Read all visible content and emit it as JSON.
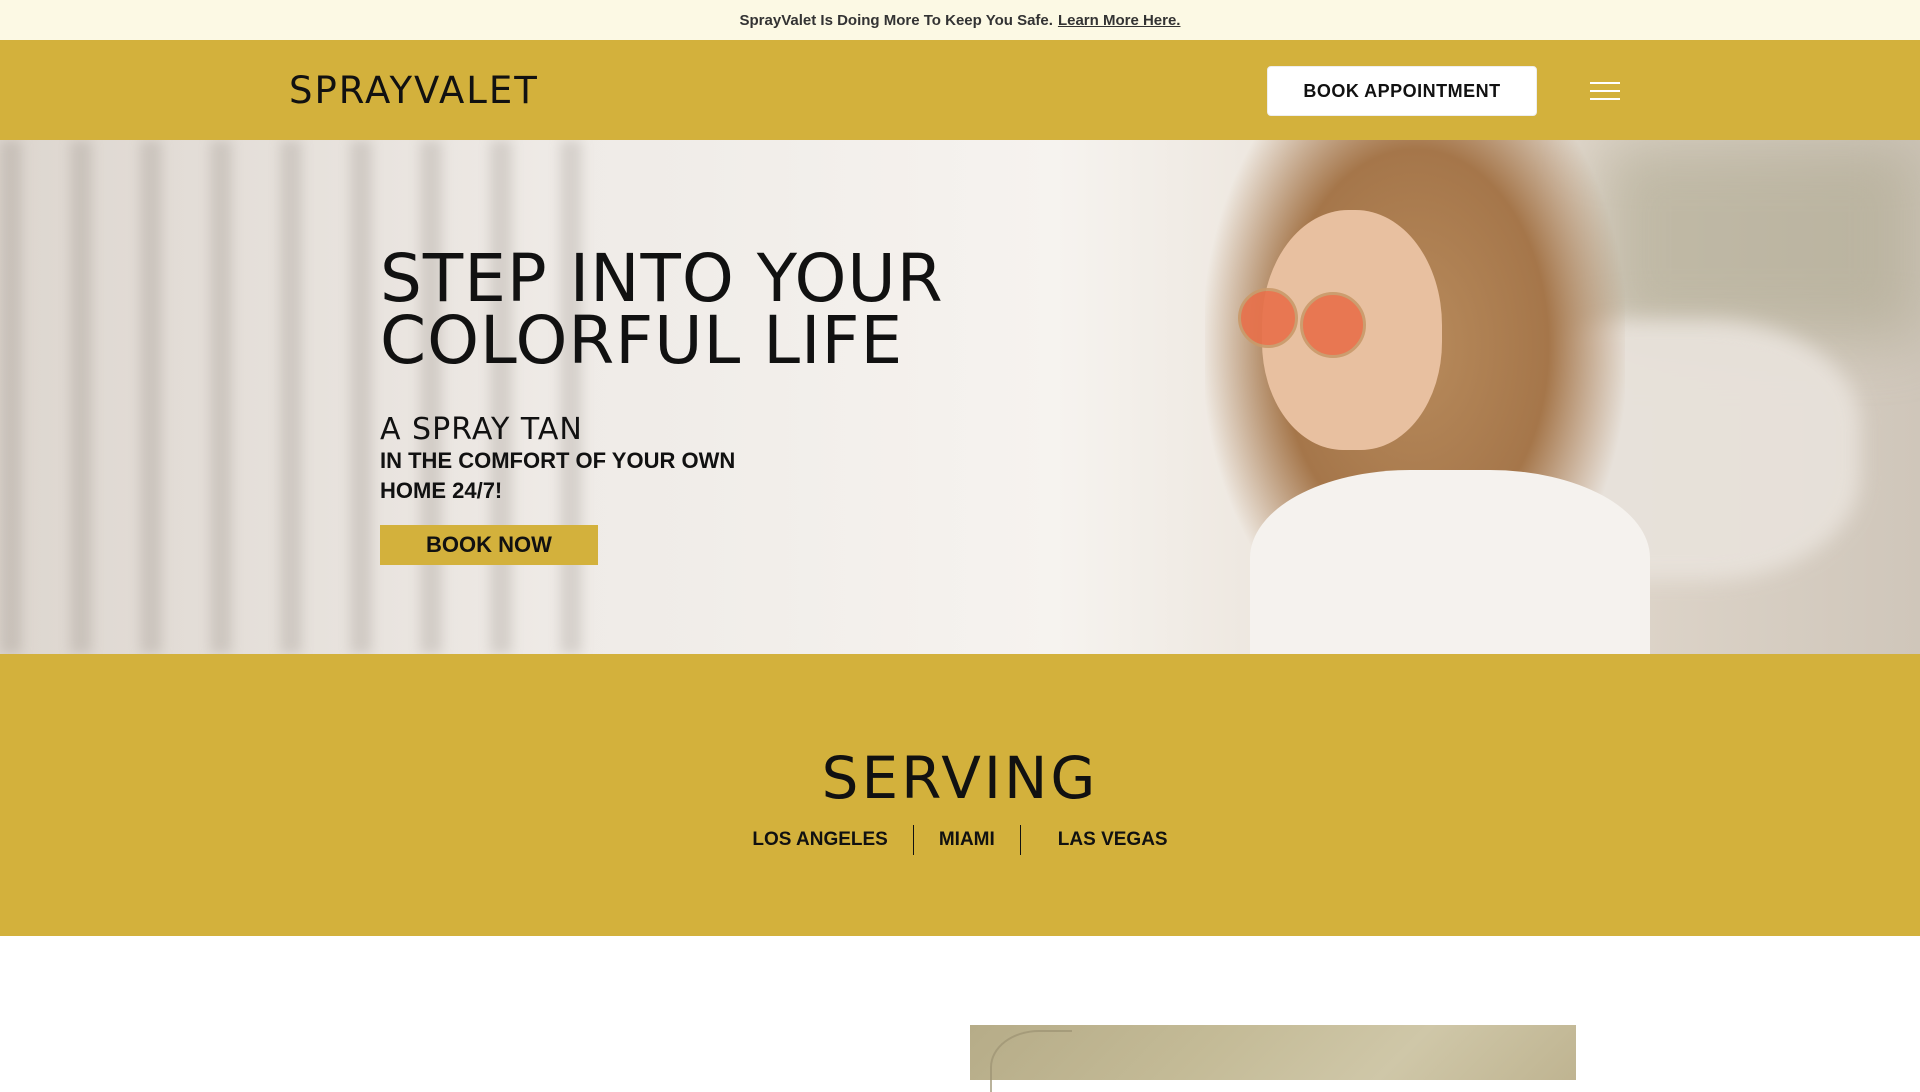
{
  "announcement": {
    "text": "SprayValet Is Doing More To Keep You Safe.",
    "link": "Learn More Here."
  },
  "header": {
    "logo": "SPRAYVALET",
    "book_button": "BOOK APPOINTMENT",
    "menu_icon": "hamburger-menu-icon"
  },
  "hero": {
    "title_line1": "STEP INTO YOUR",
    "title_line2": "COLORFUL LIFE",
    "subtitle": "A SPRAY TAN",
    "tagline": "IN THE COMFORT OF YOUR OWN HOME 24/7!",
    "cta": "BOOK NOW"
  },
  "serving": {
    "title": "SERVING",
    "cities": [
      "LOS ANGELES",
      "MIAMI",
      "LAS VEGAS"
    ]
  },
  "colors": {
    "brand_gold": "#d3b13c",
    "announce_bg": "#fcf9e4"
  }
}
